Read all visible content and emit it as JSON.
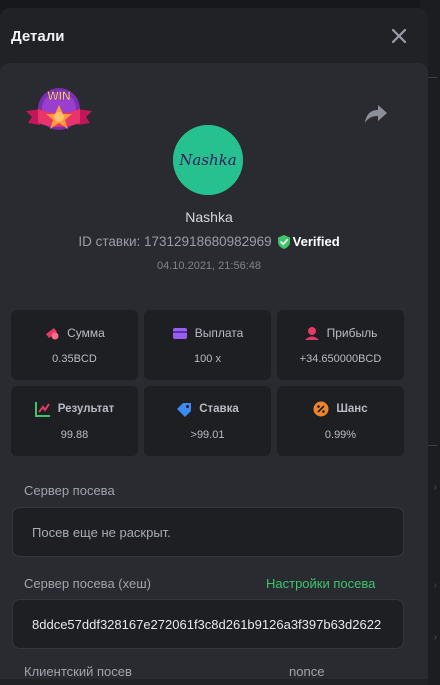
{
  "modal": {
    "title": "Детали",
    "close_icon": "close-icon"
  },
  "badge": {
    "text": "WIN"
  },
  "player": {
    "avatar_text": "Nashka",
    "name": "Nashka",
    "bet_id": "ID ставки: 17312918680982969",
    "verified_label": "Verified",
    "timestamp": "04.10.2021, 21:56:48"
  },
  "stats": [
    {
      "label": "Сумма",
      "value": "0.35BCD",
      "icon": "coins-icon",
      "color": "#e63a64"
    },
    {
      "label": "Выплата",
      "value": "100 x",
      "icon": "wallet-icon",
      "color": "#9b5cf0"
    },
    {
      "label": "Прибыль",
      "value": "+34.650000BCD",
      "icon": "profit-icon",
      "color": "#e63a64"
    },
    {
      "label": "Результат",
      "value": "99.88",
      "icon": "result-chart-icon",
      "color": "#3ec46d"
    },
    {
      "label": "Ставка",
      "value": ">99.01",
      "icon": "tag-icon",
      "color": "#3d8bf2"
    },
    {
      "label": "Шанс",
      "value": "0.99%",
      "icon": "percent-icon",
      "color": "#f0842c"
    }
  ],
  "seed": {
    "server_seed_label": "Сервер посева",
    "server_seed_value": "Посев еще не раскрыт.",
    "server_hash_label": "Сервер посева (хеш)",
    "seed_settings_link": "Настройки посева",
    "server_hash_value": "8ddce57ddf328167e272061f3c8d261b9126a3f397b63d2622",
    "client_seed_label": "Клиентский посев",
    "nonce_label": "nonce"
  },
  "colors": {
    "accent_green": "#3ec46d",
    "avatar_bg": "#27c190",
    "modal_bg": "#202226",
    "card_bg": "#292b30"
  }
}
